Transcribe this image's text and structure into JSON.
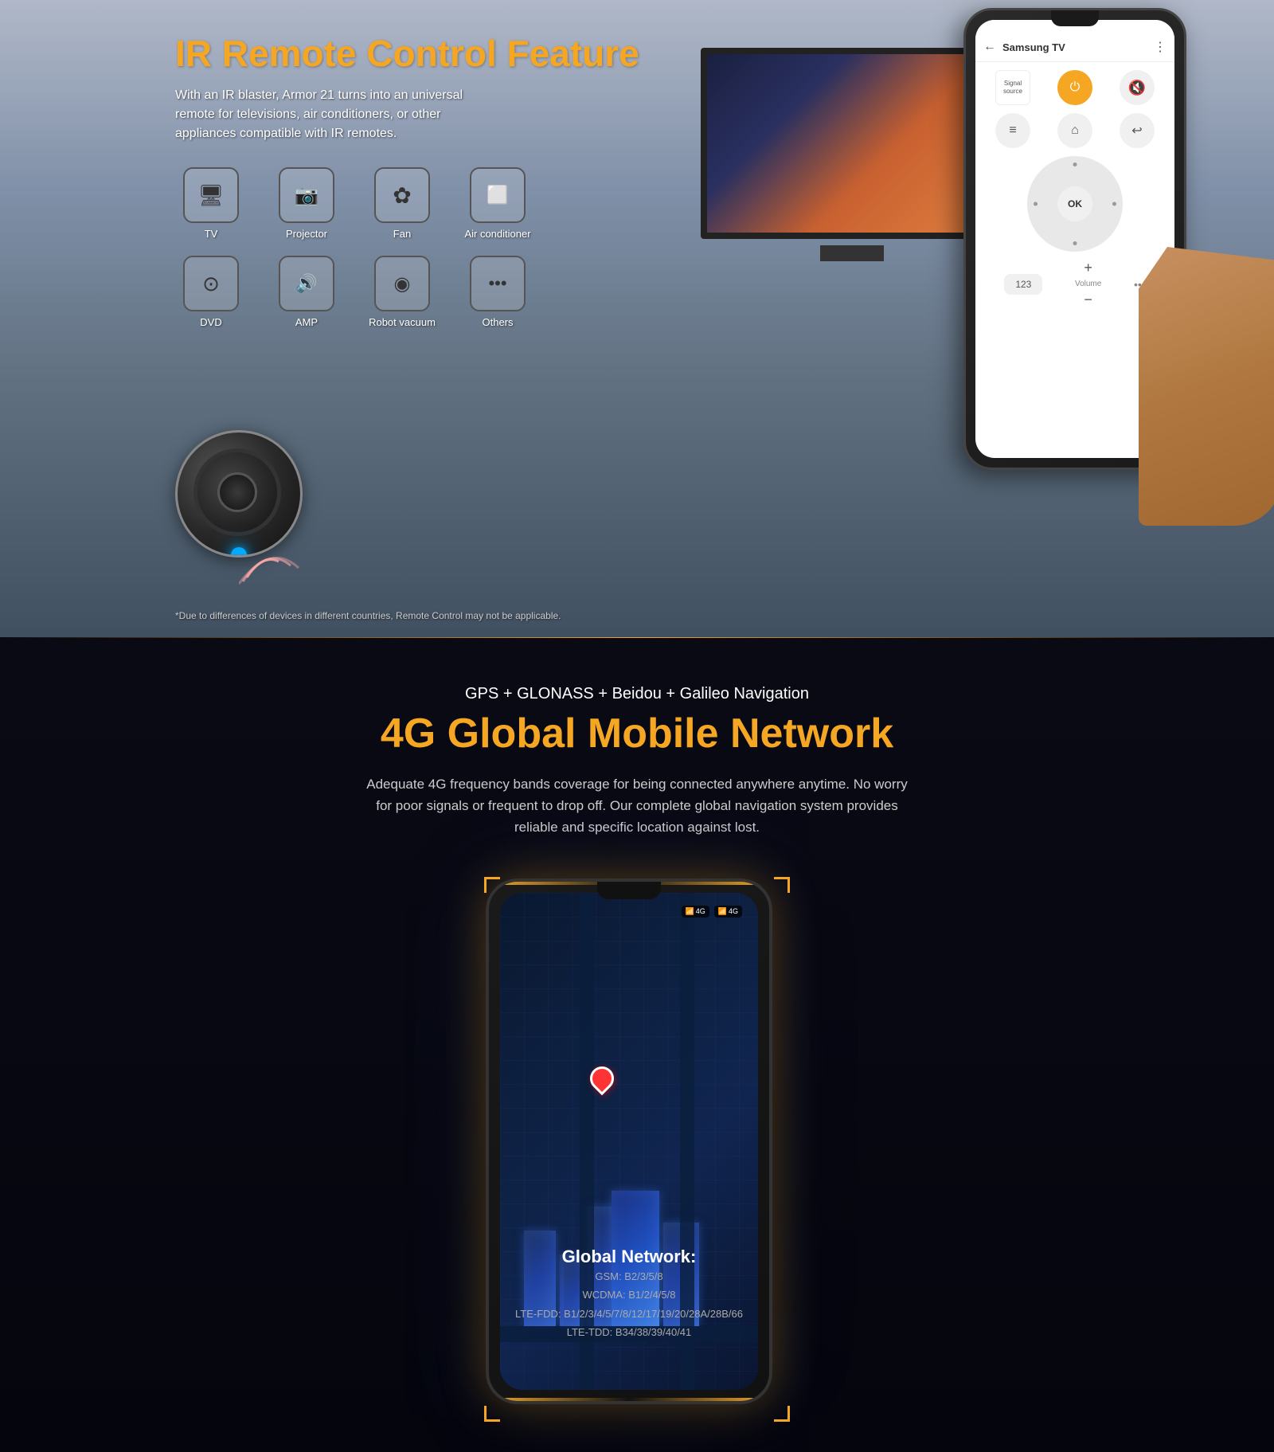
{
  "ir_section": {
    "title": "IR Remote Control Feature",
    "description": "With an IR blaster, Armor 21 turns into an universal remote for televisions, air conditioners, or other appliances compatible with IR remotes.",
    "disclaimer": "*Due to differences of devices in different countries, Remote Control may not be applicable.",
    "icons": [
      {
        "id": "tv",
        "label": "TV",
        "symbol": "📺"
      },
      {
        "id": "projector",
        "label": "Projector",
        "symbol": "📽"
      },
      {
        "id": "fan",
        "label": "Fan",
        "symbol": "🌀"
      },
      {
        "id": "air-conditioner",
        "label": "Air conditioner",
        "symbol": "❄"
      },
      {
        "id": "dvd",
        "label": "DVD",
        "symbol": "💿"
      },
      {
        "id": "amp",
        "label": "AMP",
        "symbol": "🔊"
      },
      {
        "id": "robot-vacuum",
        "label": "Robot vacuum",
        "symbol": "⊙"
      },
      {
        "id": "others",
        "label": "Others",
        "symbol": "···"
      }
    ],
    "phone": {
      "app_title": "Samsung TV",
      "signal_source": "Signal source",
      "ok_label": "OK",
      "num_label": "123",
      "vol_label": "Volume"
    }
  },
  "gps_section": {
    "subtitle": "GPS + GLONASS + Beidou + Galileo Navigation",
    "title": "4G Global Mobile Network",
    "description": "Adequate 4G frequency bands coverage for being connected anywhere anytime. No worry for poor signals or frequent to drop off. Our complete global navigation system  provides reliable and specific location against lost.",
    "network_title": "Global Network:",
    "specs": [
      "GSM: B2/3/5/8",
      "WCDMA: B1/2/4/5/8",
      "LTE-FDD: B1/2/3/4/5/7/8/12/17/19/20/28A/28B/66",
      "LTE-TDD: B34/38/39/40/41"
    ],
    "signal_badges": [
      "4G ▪▪▪",
      "4G ▪▪▪"
    ]
  }
}
